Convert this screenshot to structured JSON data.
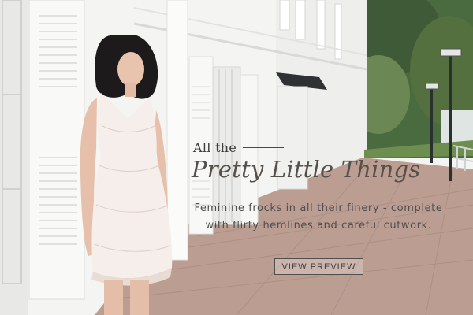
{
  "banner": {
    "kicker": "All the",
    "headline": "Pretty Little Things",
    "tagline_line1": "Feminine frocks in all their finery - complete",
    "tagline_line2": "with flirty hemlines and careful cutwork.",
    "cta_label": "VIEW PREVIEW"
  },
  "colors": {
    "text_dark": "#3d3d3d",
    "headline": "#555049",
    "wall": "#f2f2f0",
    "pavement": "#b99a8f",
    "foliage": "#3f5a36"
  }
}
